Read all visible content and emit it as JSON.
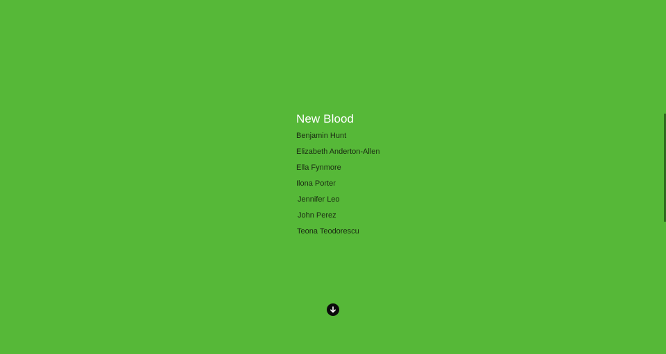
{
  "section": {
    "title": "New Blood",
    "names": [
      "Benjamin Hunt",
      "Elizabeth Anderton-Allen",
      "Ella Fynmore",
      "Ilona Porter",
      "Jennifer Leo",
      "John Perez",
      "Teona Teodorescu"
    ]
  },
  "icons": {
    "scroll_down": "arrow-down-circle-icon"
  },
  "colors": {
    "background": "#56b838",
    "title": "#ffffff",
    "name_text": "#1a2a12",
    "button": "#0c0c0c"
  }
}
